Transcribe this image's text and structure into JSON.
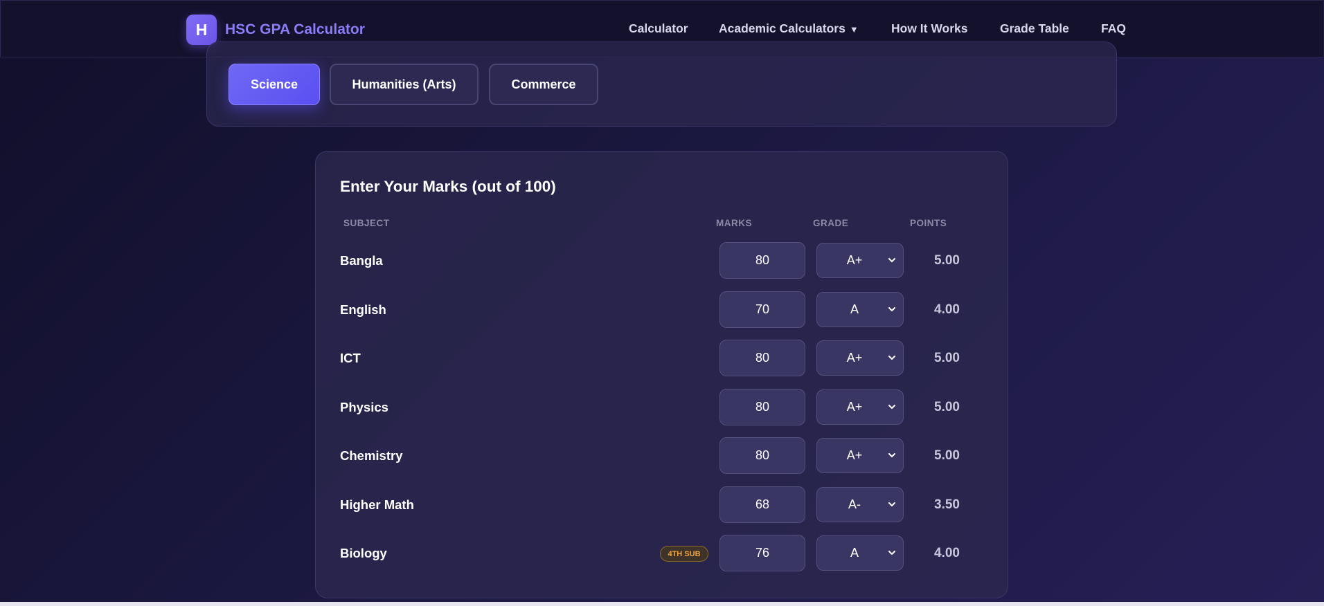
{
  "brand": {
    "logo_letter": "H",
    "name": "HSC GPA Calculator"
  },
  "nav": {
    "items": [
      {
        "label": "Calculator"
      },
      {
        "label": "Academic Calculators",
        "caret": "▼"
      },
      {
        "label": "How It Works"
      },
      {
        "label": "Grade Table"
      },
      {
        "label": "FAQ"
      }
    ]
  },
  "streams": {
    "selected": "Science",
    "items": [
      {
        "label": "Science"
      },
      {
        "label": "Humanities (Arts)"
      },
      {
        "label": "Commerce"
      }
    ]
  },
  "marks": {
    "title": "Enter Your Marks (out of 100)",
    "columns": {
      "subject": "SUBJECT",
      "marks": "MARKS",
      "grade": "GRADE",
      "points": "POINTS"
    },
    "rows": [
      {
        "subject": "Bangla",
        "marks": "80",
        "grade": "A+",
        "points": "5.00"
      },
      {
        "subject": "English",
        "marks": "70",
        "grade": "A",
        "points": "4.00"
      },
      {
        "subject": "ICT",
        "marks": "80",
        "grade": "A+",
        "points": "5.00"
      },
      {
        "subject": "Physics",
        "marks": "80",
        "grade": "A+",
        "points": "5.00"
      },
      {
        "subject": "Chemistry",
        "marks": "80",
        "grade": "A+",
        "points": "5.00"
      },
      {
        "subject": "Higher Math",
        "marks": "68",
        "grade": "A-",
        "points": "3.50"
      },
      {
        "subject": "Biology",
        "badge": "4TH SUB",
        "marks": "76",
        "grade": "A",
        "points": "4.00"
      }
    ]
  },
  "colors": {
    "accent": "#6f68f5",
    "brand_text": "#8b7cf8",
    "badge_text": "#f0a53a",
    "background": "#1b1840"
  }
}
